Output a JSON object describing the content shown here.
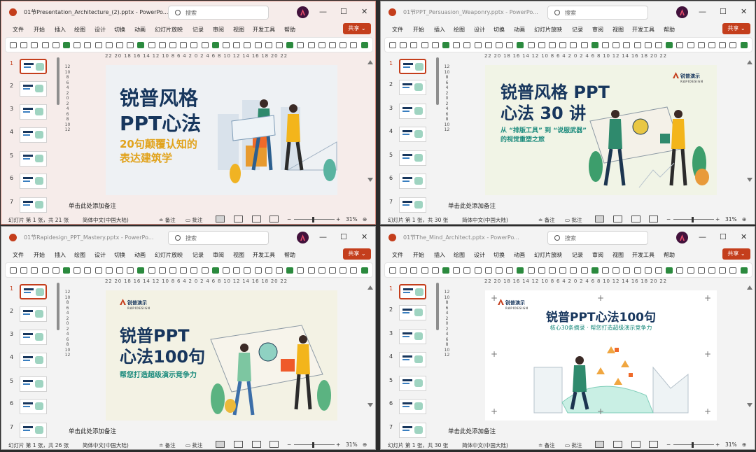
{
  "menu": [
    "文件",
    "开始",
    "插入",
    "绘图",
    "设计",
    "切换",
    "动画",
    "幻灯片放映",
    "记录",
    "审阅",
    "视图",
    "开发工具",
    "帮助"
  ],
  "search_placeholder": "搜索",
  "share_label": "共享",
  "notes_placeholder": "单击此处添加备注",
  "status": {
    "language": "简体中文(中国大陆)",
    "notes": "备注",
    "comments": "批注",
    "zoom": "31%"
  },
  "ruler_h": "22 20 18 16 14 12 10 8 6 4 2 0 2 4 6 8 10 12 14 16 18 20 22",
  "ruler_v": "12 10 8 6 4 2 0 2 4 6 8 10 12",
  "windows": [
    {
      "title": "01节Presentation_Architecture_(2).pptx - PowerPo...",
      "slide_count": "幻灯片 第 1 张，共 21 张",
      "slide": {
        "title": "锐普风格\nPPT心法",
        "subtitle": "20句颠覆认知的\n表达建筑学"
      }
    },
    {
      "title": "01节PPT_Persuasion_Weaponry.pptx - PowerPo...",
      "slide_count": "幻灯片 第 1 张，共 30 张",
      "slide": {
        "title": "锐普风格 PPT\n心法 30 讲",
        "subtitle": "从 “排版工具” 到 “说服武器”\n的视觉重塑之旅",
        "logo": "锐普演示",
        "logo_sub": "RAPIDESIGN"
      }
    },
    {
      "title": "01节Rapidesign_PPT_Mastery.pptx - PowerPo...",
      "slide_count": "幻灯片 第 1 张，共 26 张",
      "slide": {
        "title": "锐普PPT\n心法100句",
        "subtitle": "帮您打造超级演示竞争力",
        "logo": "锐普演示",
        "logo_sub": "RAPIDESIGN"
      }
    },
    {
      "title": "01节The_Mind_Architect.pptx - PowerPo...",
      "slide_count": "幻灯片 第 1 张，共 30 张",
      "slide": {
        "title": "锐普PPT心法100句",
        "subtitle": "核心30条摘录 · 帮您打造超级演示竞争力",
        "logo": "锐普演示",
        "logo_sub": "RAPIDESIGN"
      }
    }
  ],
  "thumb_numbers": [
    "1",
    "2",
    "3",
    "4",
    "5",
    "6",
    "7"
  ]
}
